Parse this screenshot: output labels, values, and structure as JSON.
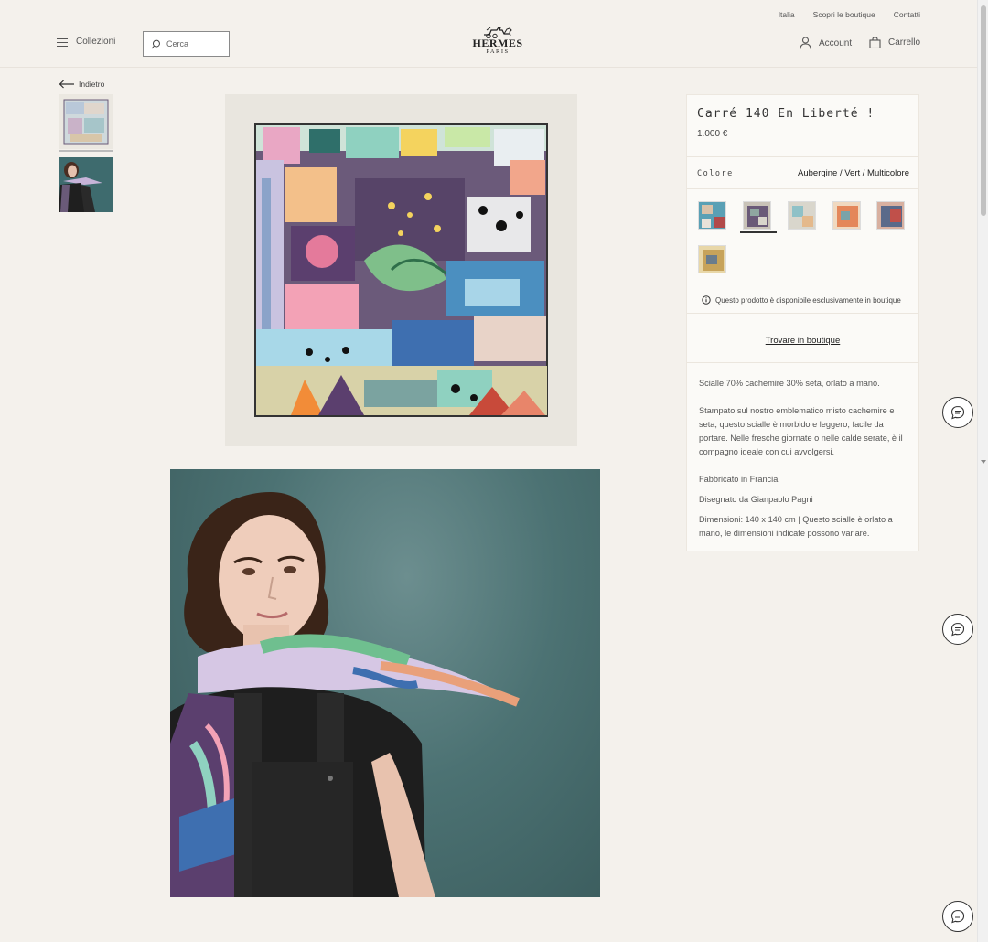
{
  "header": {
    "util_links": [
      "Italia",
      "Scopri le boutique",
      "Contatti"
    ],
    "menu_label": "Collezioni",
    "search_placeholder": "Cerca",
    "logo_word": "HERMES",
    "logo_sub": "PARIS",
    "account_label": "Account",
    "cart_label": "Carrello"
  },
  "nav": {
    "back_label": "Indietro"
  },
  "product": {
    "title": "Carré 140 En Liberté !",
    "price": "1.000 €",
    "color_label": "Colore",
    "color_value": "Aubergine / Vert / Multicolore",
    "swatches": [
      {
        "name": "swatch-blue",
        "colors": [
          "#5aa0b5",
          "#d9c1a8",
          "#b24a4a"
        ]
      },
      {
        "name": "swatch-aubergine",
        "colors": [
          "#6a5a78",
          "#c9c3b8",
          "#8fa7a0"
        ]
      },
      {
        "name": "swatch-light",
        "colors": [
          "#d9d6cc",
          "#8fc1c7",
          "#e4b98c"
        ]
      },
      {
        "name": "swatch-orange",
        "colors": [
          "#e4875a",
          "#f0d9c0",
          "#7aa3a8"
        ]
      },
      {
        "name": "swatch-red",
        "colors": [
          "#5a6a8a",
          "#c0504a",
          "#d8b0a0"
        ]
      },
      {
        "name": "swatch-gold",
        "colors": [
          "#c7a35a",
          "#6a7c8c",
          "#e8d7a8"
        ]
      }
    ],
    "selected_swatch": 1,
    "availability_note": "Questo prodotto è disponibile esclusivamente in boutique",
    "find_link": "Trovare in boutique",
    "description": {
      "composition": "Scialle 70% cachemire 30% seta, orlato a mano.",
      "paragraph": "Stampato sul nostro emblematico misto cachemire e seta, questo scialle è morbido e leggero, facile da portare. Nelle fresche giornate o nelle calde serate, è il compagno ideale con cui avvolgersi.",
      "made_in": "Fabbricato in Francia",
      "designer": "Disegnato da Gianpaolo Pagni",
      "dimensions": "Dimensioni: 140 x 140 cm | Questo scialle è orlato a mano, le dimensioni indicate possono variare."
    }
  },
  "colors": {
    "background": "#f4f1ec",
    "panel": "#fbfaf7",
    "text": "#333333"
  }
}
